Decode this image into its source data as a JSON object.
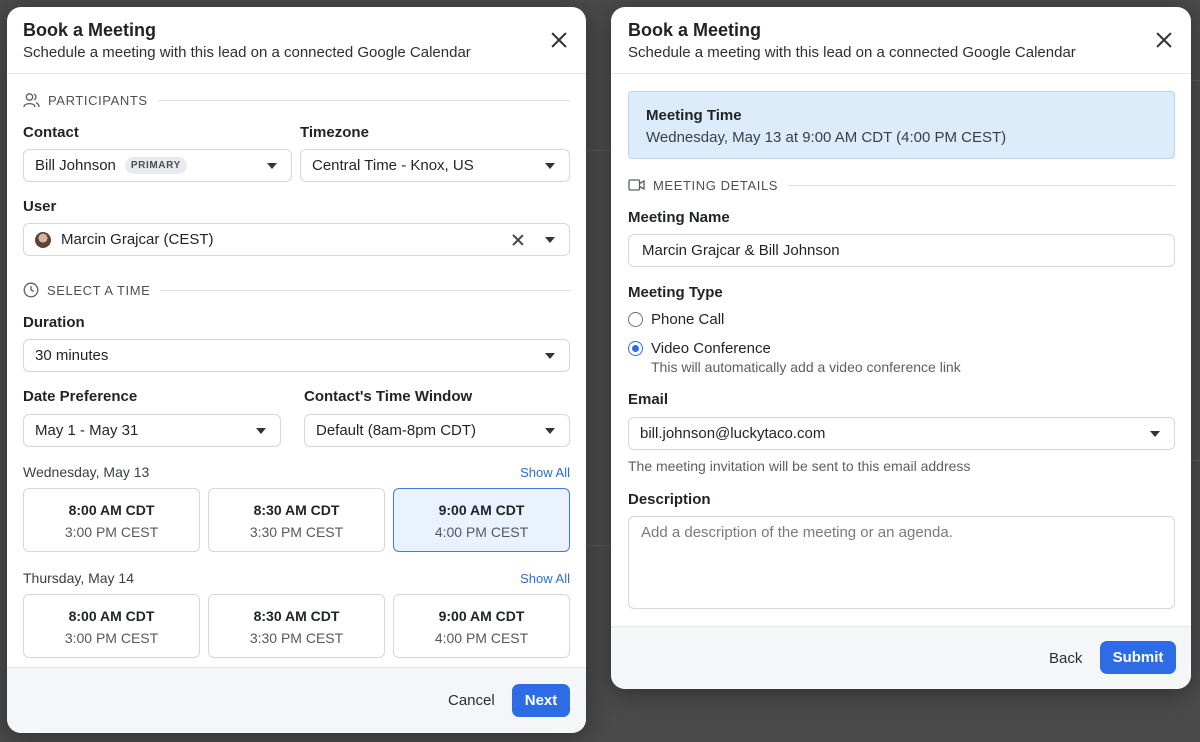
{
  "left": {
    "title": "Book a Meeting",
    "subtitle": "Schedule a meeting with this lead on a connected Google Calendar",
    "participants_heading": "PARTICIPANTS",
    "contact_label": "Contact",
    "contact_value": "Bill Johnson",
    "contact_badge": "PRIMARY",
    "timezone_label": "Timezone",
    "timezone_value": "Central Time - Knox, US",
    "user_label": "User",
    "user_value": "Marcin Grajcar (CEST)",
    "select_time_heading": "SELECT A TIME",
    "duration_label": "Duration",
    "duration_value": "30 minutes",
    "date_pref_label": "Date Preference",
    "date_pref_value": "May 1 - May 31",
    "window_label": "Contact's Time Window",
    "window_value": "Default (8am-8pm CDT)",
    "show_all": "Show All",
    "days": [
      {
        "label": "Wednesday, May 13",
        "slots": [
          {
            "primary": "8:00 AM CDT",
            "secondary": "3:00 PM CEST"
          },
          {
            "primary": "8:30 AM CDT",
            "secondary": "3:30 PM CEST"
          },
          {
            "primary": "9:00 AM CDT",
            "secondary": "4:00 PM CEST"
          }
        ]
      },
      {
        "label": "Thursday, May 14",
        "slots": [
          {
            "primary": "8:00 AM CDT",
            "secondary": "3:00 PM CEST"
          },
          {
            "primary": "8:30 AM CDT",
            "secondary": "3:30 PM CEST"
          },
          {
            "primary": "9:00 AM CDT",
            "secondary": "4:00 PM CEST"
          }
        ]
      }
    ],
    "cancel_label": "Cancel",
    "next_label": "Next"
  },
  "right": {
    "title": "Book a Meeting",
    "subtitle": "Schedule a meeting with this lead on a connected Google Calendar",
    "meeting_time_title": "Meeting Time",
    "meeting_time_value": "Wednesday, May 13 at 9:00 AM CDT (4:00 PM CEST)",
    "details_heading": "MEETING DETAILS",
    "name_label": "Meeting Name",
    "name_value": "Marcin Grajcar & Bill Johnson",
    "type_label": "Meeting Type",
    "type_phone": "Phone Call",
    "type_video": "Video Conference",
    "type_video_hint": "This will automatically add a video conference link",
    "email_label": "Email",
    "email_value": "bill.johnson@luckytaco.com",
    "email_hint": "The meeting invitation will be sent to this email address",
    "description_label": "Description",
    "description_placeholder": "Add a description of the meeting or an agenda.",
    "back_label": "Back",
    "submit_label": "Submit"
  },
  "colors": {
    "accent": "#2d6ce4",
    "selected_slot_bg": "#eaf2ff",
    "info_bg": "#dcecfb"
  }
}
